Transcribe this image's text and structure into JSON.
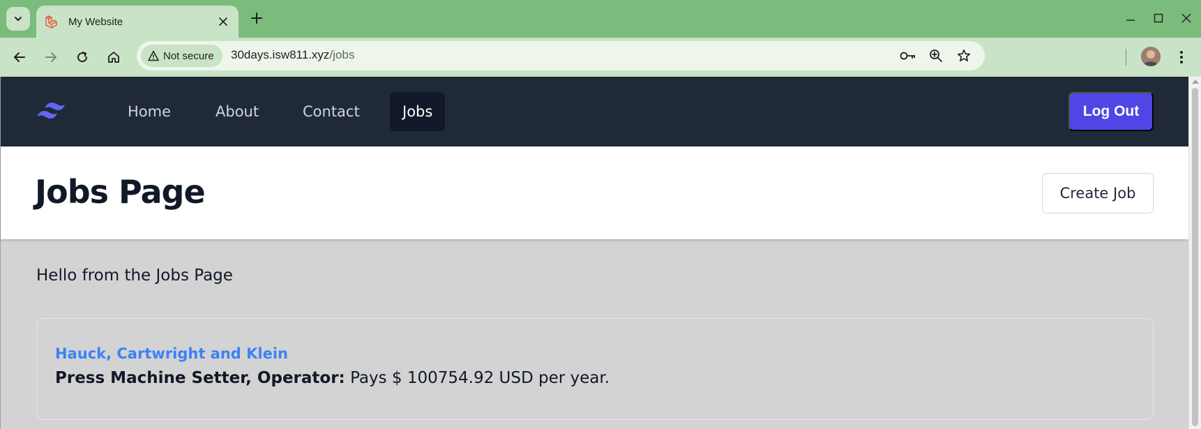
{
  "browser": {
    "tab_title": "My Website",
    "security_label": "Not secure",
    "url_host": "30days.isw811.xyz",
    "url_path": "/jobs",
    "colors": {
      "frame": "#7bbb7b",
      "toolbar": "#c9e3c6"
    }
  },
  "nav": {
    "links": [
      {
        "label": "Home"
      },
      {
        "label": "About"
      },
      {
        "label": "Contact"
      },
      {
        "label": "Jobs"
      }
    ],
    "logout_label": "Log Out",
    "colors": {
      "bar": "#1f2937",
      "active": "#111827",
      "logout": "#4f46e5",
      "logo": "#6366f1"
    }
  },
  "header": {
    "title": "Jobs Page",
    "create_label": "Create Job"
  },
  "main": {
    "greeting": "Hello from the Jobs Page",
    "jobs": [
      {
        "employer": "Hauck, Cartwright and Klein",
        "title": "Press Machine Setter, Operator:",
        "pay_text": "Pays $ 100754.92 USD per year."
      }
    ],
    "colors": {
      "employer": "#3b82f6"
    }
  }
}
